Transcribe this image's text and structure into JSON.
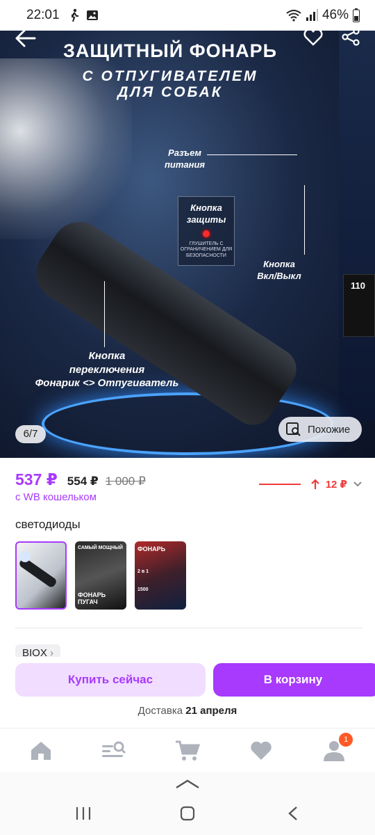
{
  "status_bar": {
    "time": "22:01",
    "battery": "46%"
  },
  "gallery": {
    "title_line1": "ЗАЩИТНЫЙ ФОНАРЬ",
    "title_line2": "С ОТПУГИВАТЕЛЕМ",
    "title_line3": "ДЛЯ СОБАК",
    "callout_power_line1": "Разъем",
    "callout_power_line2": "питания",
    "callout_protect_line1": "Кнопка",
    "callout_protect_line2": "защиты",
    "callout_protect_note": "ГЛУШИТЕЛЬ С ОГРАНИЧЕНИЕМ ДЛЯ БЕЗОПАСНОСТИ",
    "callout_onoff_line1": "Кнопка",
    "callout_onoff_line2": "Вкл/Выкл",
    "callout_switch_line1": "Кнопка",
    "callout_switch_line2": "переключения",
    "callout_switch_line3": "Фонарик <> Отпугиватель",
    "side_label": "110",
    "counter": "6/7",
    "similar_label": "Похожие"
  },
  "pricing": {
    "price": "537 ₽",
    "price_without_wallet": "554 ₽",
    "old_price": "1 000 ₽",
    "wallet_label": "с WB кошельком",
    "trend_value": "12 ₽"
  },
  "variants": {
    "title": "светодиоды",
    "thumb2_label_top": "САМЫЙ МОЩНЫЙ",
    "thumb2_label_bottom": "ФОНАРЬ ПУГАЧ",
    "thumb3_label_top": "ФОНАРЬ",
    "thumb3_label_mid": "2 в 1",
    "thumb3_label_bottom": "1500"
  },
  "brand": {
    "label": "BIOX"
  },
  "actions": {
    "buy_now": "Купить сейчас",
    "add_to_cart": "В корзину",
    "delivery_prefix": "Доставка",
    "delivery_date": "21 апреля"
  },
  "tabbar": {
    "profile_badge": "1"
  },
  "colors": {
    "accent": "#a73afd",
    "accent_light": "#f1ddff",
    "trend": "#f03a3a",
    "badge": "#ff5a26"
  }
}
